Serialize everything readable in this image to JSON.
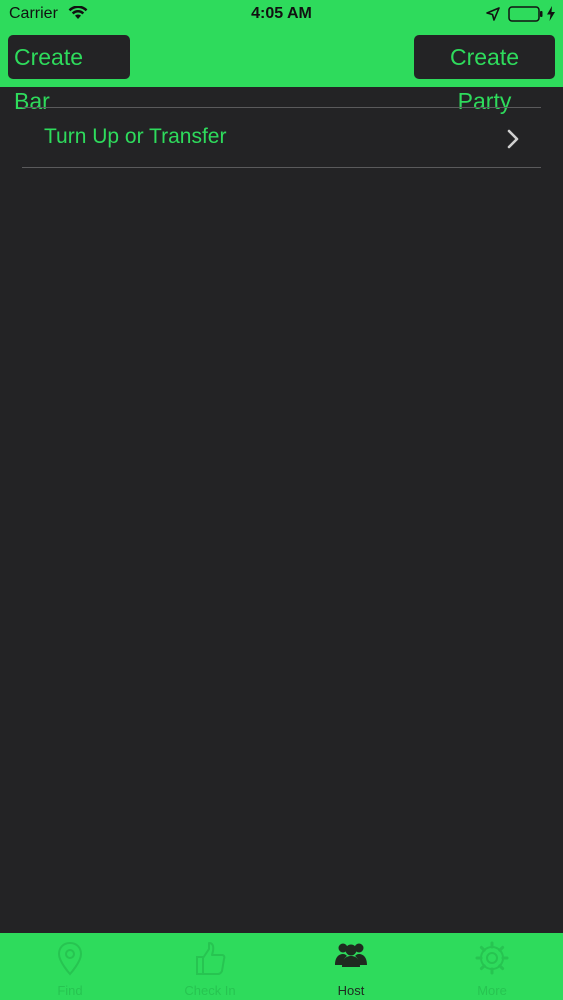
{
  "status_bar": {
    "carrier": "Carrier",
    "time": "4:05 AM",
    "wifi_icon": "wifi-icon",
    "location_icon": "location-arrow-icon",
    "battery_icon": "battery-icon",
    "charge_icon": "charging-bolt-icon"
  },
  "nav": {
    "left_button": "Create Bar",
    "right_button": "Create Party"
  },
  "list": {
    "items": [
      {
        "label": "Turn Up or Transfer",
        "icon": "chevron-right-icon"
      }
    ]
  },
  "tabbar": {
    "tabs": [
      {
        "label": "Find",
        "icon": "map-pin-icon",
        "selected": false
      },
      {
        "label": "Check In",
        "icon": "thumbs-up-icon",
        "selected": false
      },
      {
        "label": "Host",
        "icon": "group-icon",
        "selected": true
      },
      {
        "label": "More",
        "icon": "gear-icon",
        "selected": false
      }
    ]
  },
  "colors": {
    "accent": "#2edb5c",
    "background": "#232325",
    "separator": "#5a5a5c",
    "inactive_tab": "#27c451",
    "active_tab": "#1f2a20"
  }
}
